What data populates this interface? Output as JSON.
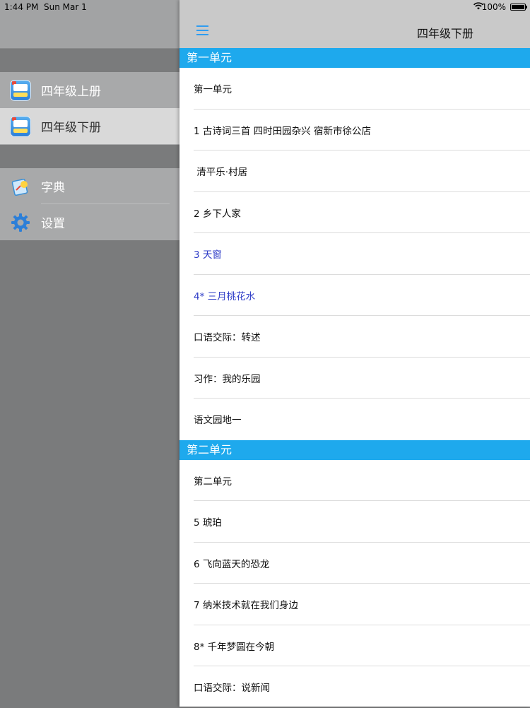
{
  "status": {
    "time": "1:44 PM",
    "date": "Sun Mar 1",
    "wifi_icon": "wifi-icon",
    "battery": "100%",
    "battery_level": 1.0
  },
  "sidebar": {
    "books": [
      {
        "label": "四年级上册",
        "icon": "book-icon"
      },
      {
        "label": "四年级下册",
        "icon": "book-icon"
      }
    ],
    "tools": [
      {
        "label": "字典",
        "icon": "dictionary-icon"
      },
      {
        "label": "设置",
        "icon": "gear-icon"
      }
    ]
  },
  "nav": {
    "title": "四年级下册",
    "menu_icon": "hamburger-icon"
  },
  "sections": [
    {
      "title": "第一单元",
      "items": [
        "第一单元",
        "1 古诗词三首  四时田园杂兴  宿新市徐公店",
        " 清平乐·村居",
        "2 乡下人家",
        "3 天窗",
        "4* 三月桃花水",
        "口语交际：转述",
        "习作：我的乐园",
        "语文园地一"
      ]
    },
    {
      "title": "第二单元",
      "items": [
        "第二单元",
        "5 琥珀",
        "6 飞向蓝天的恐龙",
        "7 纳米技术就在我们身边",
        "8* 千年梦圆在今朝",
        "口语交际：说新闻"
      ]
    }
  ],
  "colors": {
    "section_header": "#1ea9ed",
    "accent_blue": "#2f9cf0",
    "visited_link": "#2e3cc7"
  }
}
